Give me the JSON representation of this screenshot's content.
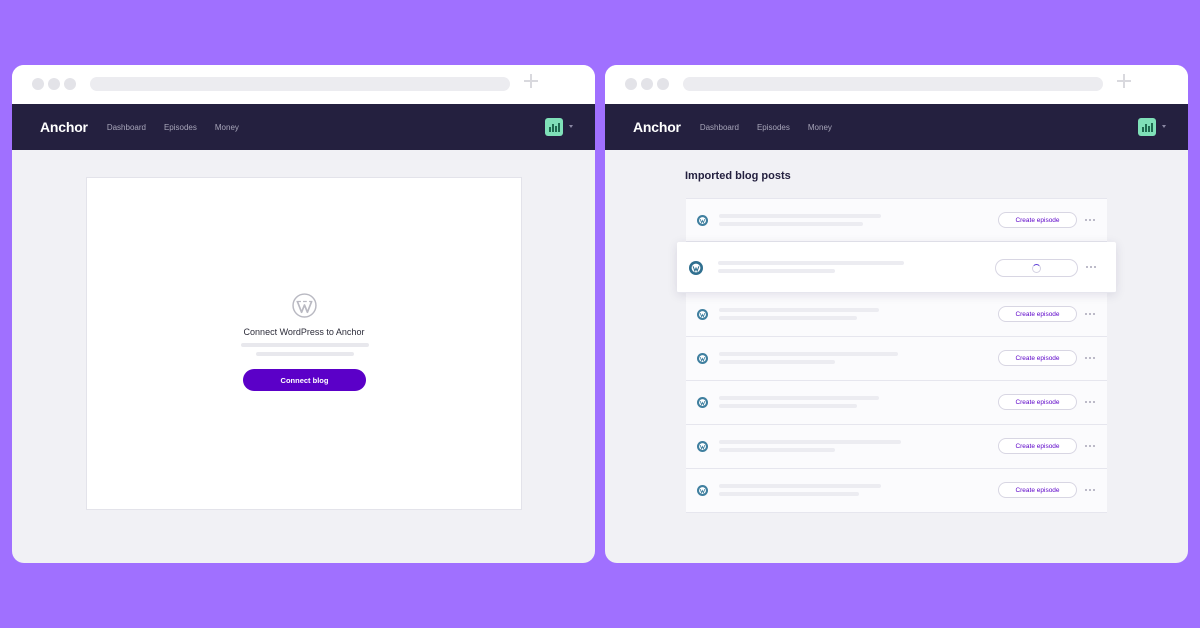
{
  "colors": {
    "background": "#a070ff",
    "navbar": "#24203f",
    "accent": "#5b00c8",
    "avatar": "#7fe0b8"
  },
  "left_window": {
    "navbar": {
      "logo": "Anchor",
      "links": [
        "Dashboard",
        "Episodes",
        "Money"
      ]
    },
    "connect_card": {
      "icon": "wordpress-icon",
      "title": "Connect WordPress to Anchor",
      "button_label": "Connect blog"
    }
  },
  "right_window": {
    "navbar": {
      "logo": "Anchor",
      "links": [
        "Dashboard",
        "Episodes",
        "Money"
      ]
    },
    "section_title": "Imported blog posts",
    "posts": [
      {
        "icon": "wordpress-icon",
        "action_label": "Create episode",
        "loading": false
      },
      {
        "icon": "wordpress-icon",
        "action_label": "",
        "loading": true
      },
      {
        "icon": "wordpress-icon",
        "action_label": "Create episode",
        "loading": false
      },
      {
        "icon": "wordpress-icon",
        "action_label": "Create episode",
        "loading": false
      },
      {
        "icon": "wordpress-icon",
        "action_label": "Create episode",
        "loading": false
      },
      {
        "icon": "wordpress-icon",
        "action_label": "Create episode",
        "loading": false
      },
      {
        "icon": "wordpress-icon",
        "action_label": "Create episode",
        "loading": false
      }
    ]
  }
}
